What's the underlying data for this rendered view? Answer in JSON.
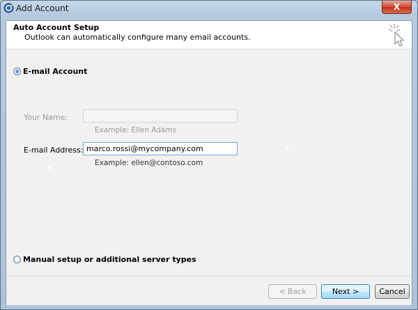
{
  "window": {
    "title": "Add Account",
    "close_glyph": "X"
  },
  "header": {
    "title": "Auto Account Setup",
    "subtitle": "Outlook can automatically configure many email accounts."
  },
  "options": {
    "email_account": {
      "label": "E-mail Account",
      "selected": true
    },
    "manual_setup": {
      "label": "Manual setup or additional server types",
      "selected": false
    }
  },
  "form": {
    "your_name": {
      "label": "Your Name:",
      "value": "",
      "example": "Example: Ellen Adams",
      "disabled": true
    },
    "email_address": {
      "label": "E-mail Address:",
      "value": "marco.rossi@mycompany.com",
      "example": "Example: ellen@contoso.com",
      "disabled": false
    }
  },
  "buttons": {
    "back": "< Back",
    "next": "Next >",
    "cancel": "Cancel"
  },
  "icons": {
    "app": "outlook-app-icon",
    "wizard": "wizard-cursor-sparkle-icon",
    "close": "close-icon"
  },
  "colors": {
    "titlebar": "#b5c9df",
    "close_button": "#c4321b",
    "default_button": "#bee6fd"
  }
}
